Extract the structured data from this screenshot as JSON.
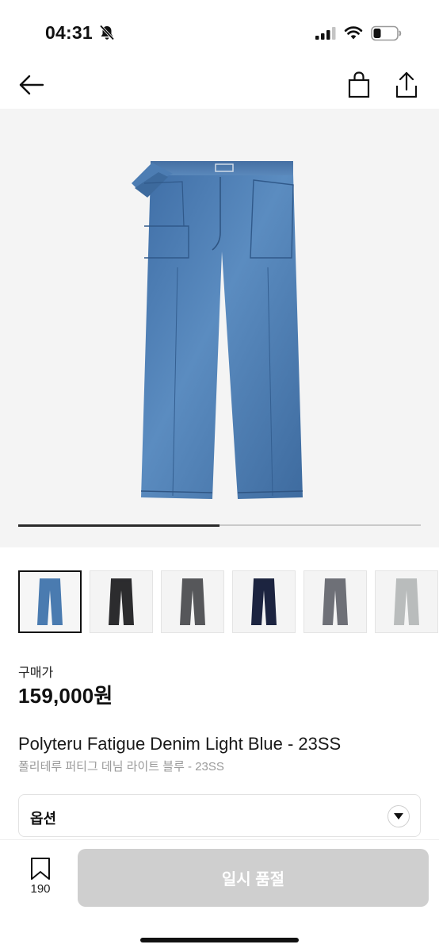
{
  "status_bar": {
    "time": "04:31"
  },
  "gallery": {
    "progress": 0.5
  },
  "thumbnails": [
    {
      "color_name": "light-blue",
      "color": "#4a7bb0"
    },
    {
      "color_name": "black",
      "color": "#2c2c2e"
    },
    {
      "color_name": "charcoal",
      "color": "#56575a"
    },
    {
      "color_name": "navy",
      "color": "#1c2440"
    },
    {
      "color_name": "gray",
      "color": "#6e7077"
    },
    {
      "color_name": "light-gray",
      "color": "#b9bcbc"
    }
  ],
  "price": {
    "label": "구매가",
    "value": "159,000원"
  },
  "product": {
    "title_en": "Polyteru Fatigue Denim Light Blue - 23SS",
    "title_ko": "폴리테루 퍼티그 데님 라이트 블루 - 23SS"
  },
  "option": {
    "label": "옵션"
  },
  "bottom_bar": {
    "wish_count": "190",
    "soldout_label": "일시 품절"
  },
  "colors": {
    "denim": "#4c7db2",
    "button_disabled": "#cfcfcf"
  }
}
